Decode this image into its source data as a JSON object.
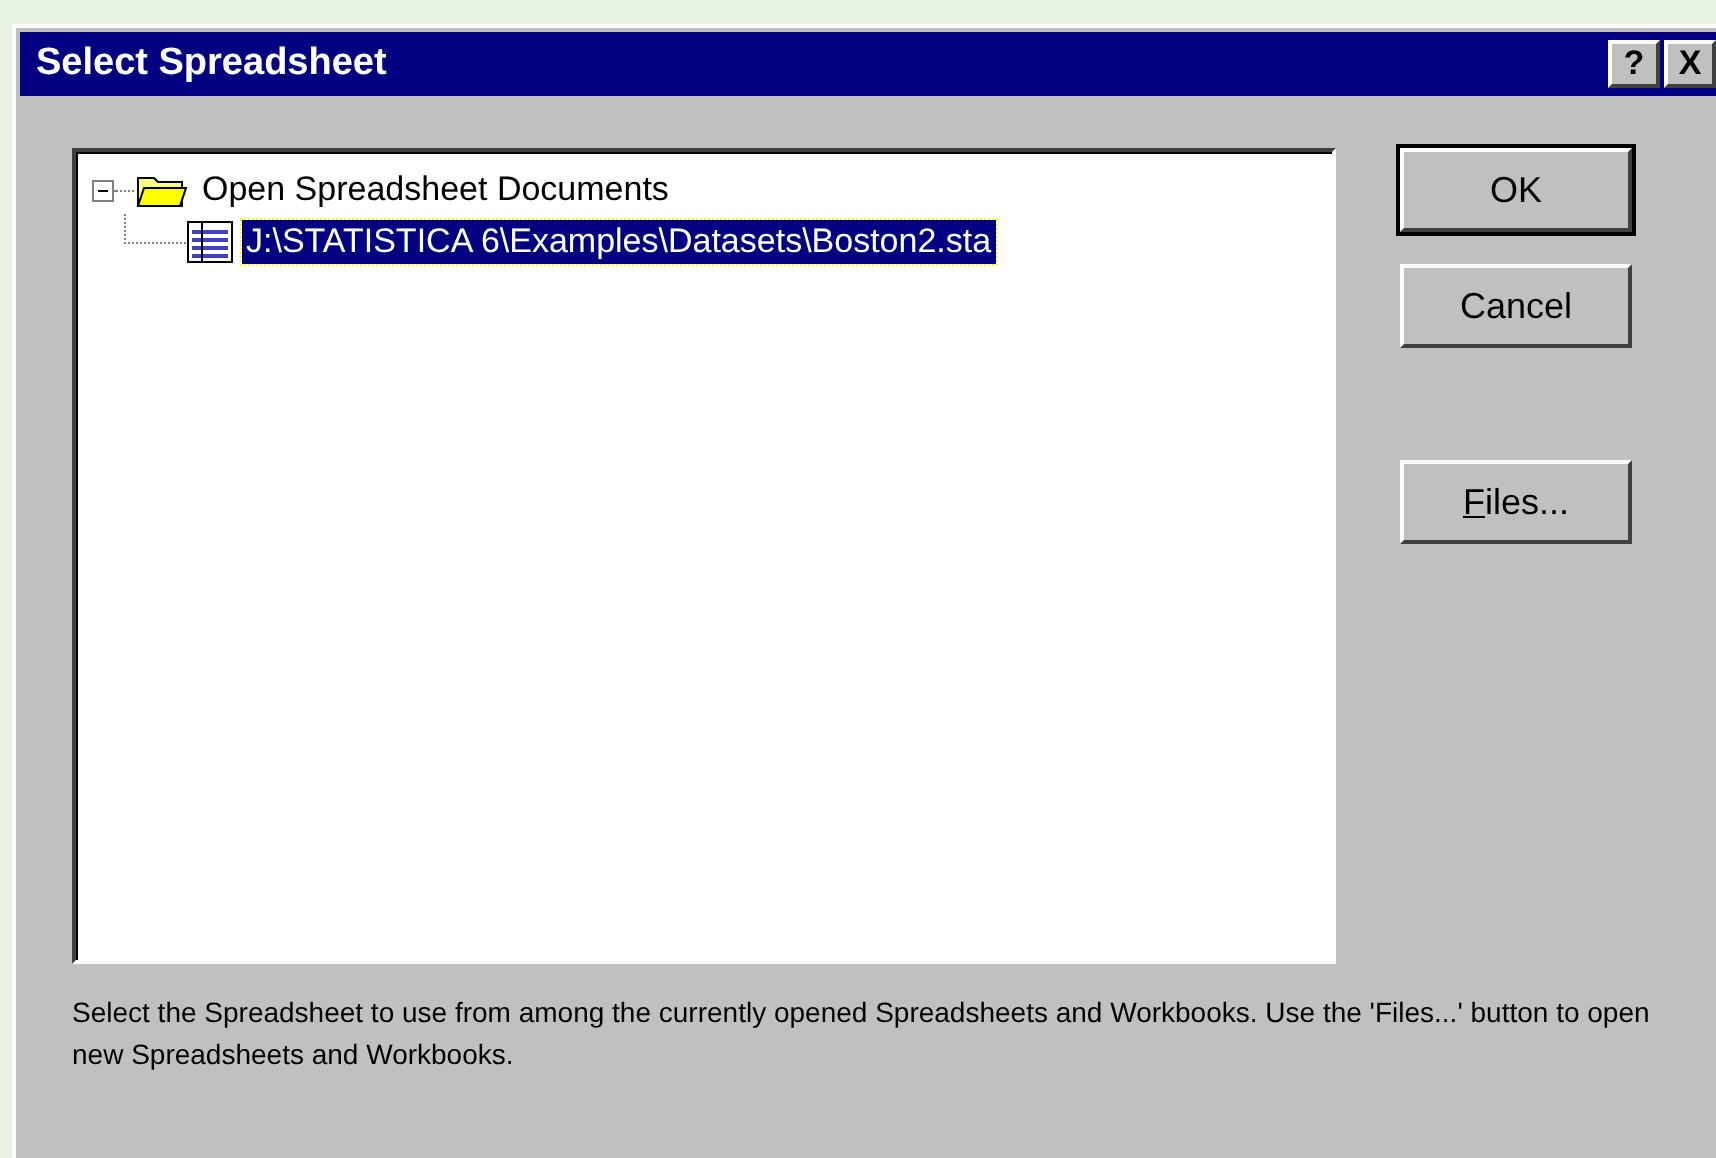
{
  "window": {
    "title": "Select Spreadsheet",
    "title_buttons": [
      "?",
      "X"
    ]
  },
  "tree": [
    {
      "label": "Open Spreadsheet Documents",
      "kind": "folder",
      "expanded": true,
      "selected": false,
      "children": [
        {
          "label": "J:\\STATISTICA 6\\Examples\\Datasets\\Boston2.sta",
          "kind": "sheet",
          "selected": true
        }
      ]
    }
  ],
  "buttons": [
    {
      "label": "OK",
      "default": true,
      "underline_first": false
    },
    {
      "label": "Cancel",
      "default": false,
      "underline_first": false
    },
    {
      "label": "Files...",
      "default": false,
      "underline_first": true
    }
  ],
  "description": "Select the Spreadsheet to use from among the currently opened Spreadsheets and Workbooks. Use the 'Files...' button to open new Spreadsheets and Workbooks."
}
